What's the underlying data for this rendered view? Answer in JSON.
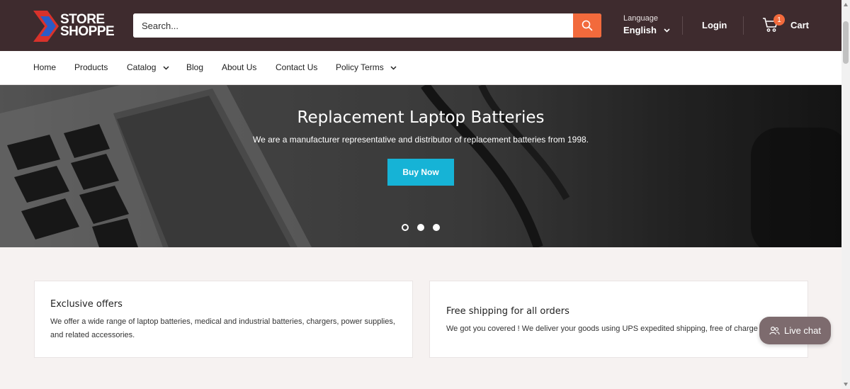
{
  "header": {
    "logo_line1": "STORE",
    "logo_line2": "SHOPPE",
    "search_placeholder": "Search...",
    "language_label": "Language",
    "language_value": "English",
    "login_label": "Login",
    "cart_label": "Cart",
    "cart_count": "1"
  },
  "nav": {
    "items": [
      "Home",
      "Products",
      "Catalog",
      "Blog",
      "About Us",
      "Contact Us",
      "Policy Terms"
    ]
  },
  "hero": {
    "title": "Replacement Laptop Batteries",
    "subtitle": "We are a manufacturer representative and distributor of replacement batteries from 1998.",
    "cta_label": "Buy Now",
    "slides_total": 3,
    "active_slide": 1
  },
  "features": [
    {
      "title": "Exclusive offers",
      "text_line1": "We offer a wide range of laptop batteries, medical and industrial batteries, chargers, power supplies,",
      "text_line2": "and related accessories."
    },
    {
      "title": "Free shipping for all orders",
      "text_line1": "We got you covered ! We deliver your goods using UPS expedited shipping, free of charge"
    }
  ],
  "livechat": {
    "label": "Live chat"
  },
  "colors": {
    "header_bg": "#3e2b2e",
    "accent_orange": "#f26a3c",
    "cta_cyan": "#16b3d6",
    "page_bg": "#f6f2f1"
  },
  "icons": [
    "search-icon",
    "chevron-down-icon",
    "cart-icon",
    "users-icon"
  ]
}
